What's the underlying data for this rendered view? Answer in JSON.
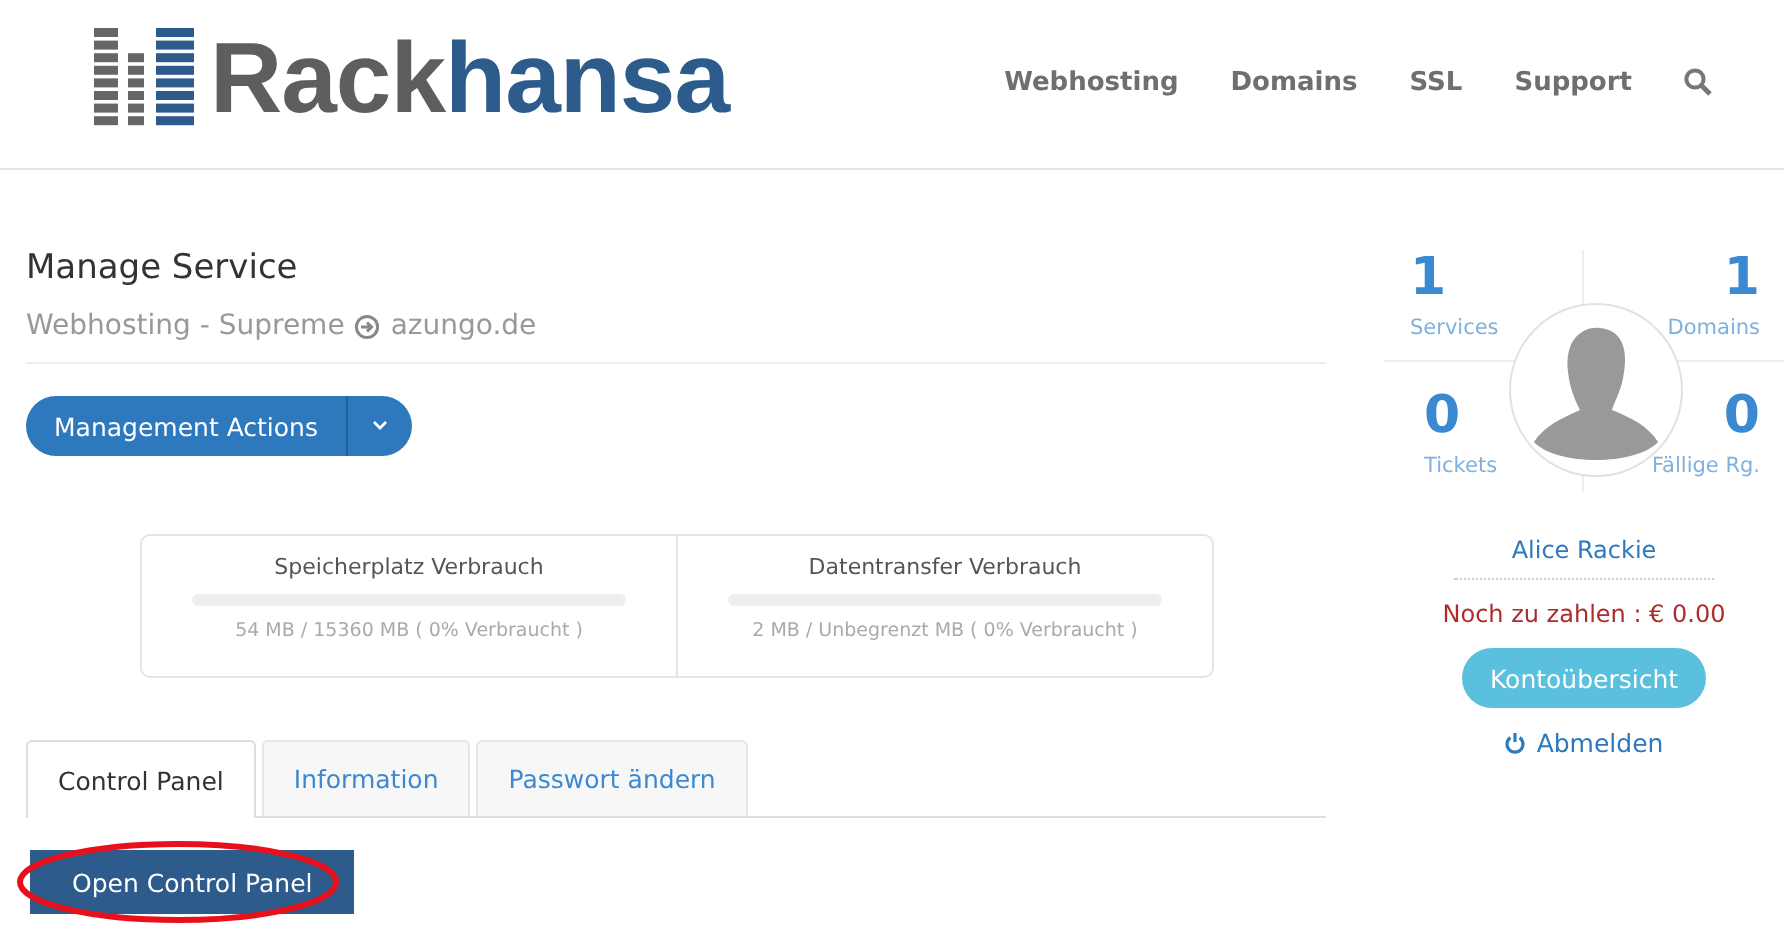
{
  "header": {
    "logo": {
      "part_1": "Rack",
      "part_2": "hansa"
    },
    "nav": [
      "Webhosting",
      "Domains",
      "SSL",
      "Support"
    ]
  },
  "service": {
    "title": "Manage Service",
    "product": "Webhosting - Supreme",
    "domain": "azungo.de",
    "actions_button": "Management Actions"
  },
  "usage": [
    {
      "title": "Speicherplatz Verbrauch",
      "level": 0,
      "reading": "54 MB / 15360 MB ( 0% Verbraucht )"
    },
    {
      "title": "Datentransfer Verbrauch",
      "level": 0,
      "reading": "2 MB / Unbegrenzt MB ( 0% Verbraucht )"
    }
  ],
  "tabs": [
    {
      "label": "Control Panel",
      "selected": true
    },
    {
      "label": "Information",
      "selected": false
    },
    {
      "label": "Passwort ändern",
      "selected": false
    }
  ],
  "open_button": "Open Control Panel",
  "sidebar": {
    "stats": [
      {
        "value": "1",
        "label": "Services"
      },
      {
        "value": "1",
        "label": "Domains"
      },
      {
        "value": "0",
        "label": "Tickets"
      },
      {
        "value": "0",
        "label": "Fällige Rg."
      }
    ],
    "user": "Alice Rackie",
    "balance": "Noch zu zahlen : € 0.00",
    "account_button": "Kontoübersicht",
    "logout": "Abmelden"
  }
}
